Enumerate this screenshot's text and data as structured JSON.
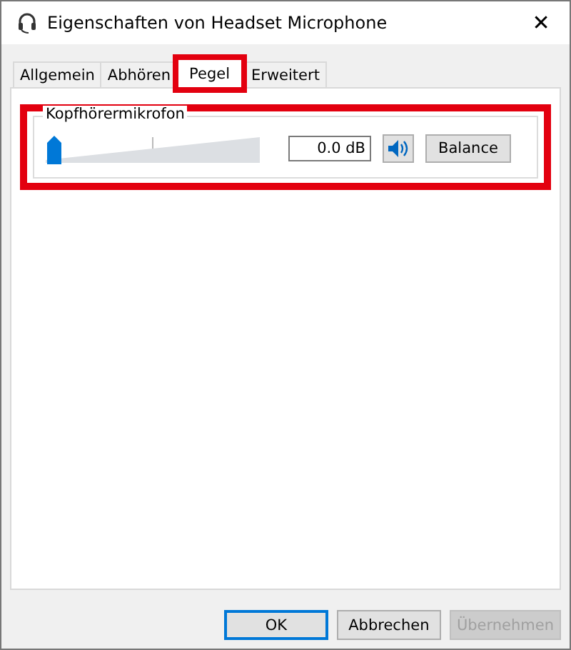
{
  "window": {
    "title": "Eigenschaften von Headset Microphone",
    "close": "✕"
  },
  "tabs": [
    {
      "label": "Allgemein",
      "selected": false,
      "highlighted": false
    },
    {
      "label": "Abhören",
      "selected": false,
      "highlighted": false
    },
    {
      "label": "Pegel",
      "selected": true,
      "highlighted": true
    },
    {
      "label": "Erweitert",
      "selected": false,
      "highlighted": false
    }
  ],
  "level_group": {
    "title": "Kopfhörermikrofon",
    "highlighted": true,
    "level": 0,
    "value": "0.0 dB",
    "muted": false,
    "balance_button": "Balance"
  },
  "buttons": [
    {
      "label": "OK",
      "default": true,
      "disabled": false
    },
    {
      "label": "Abbrechen",
      "default": false,
      "disabled": false
    },
    {
      "label": "Übernehmen",
      "default": false,
      "disabled": true
    }
  ]
}
